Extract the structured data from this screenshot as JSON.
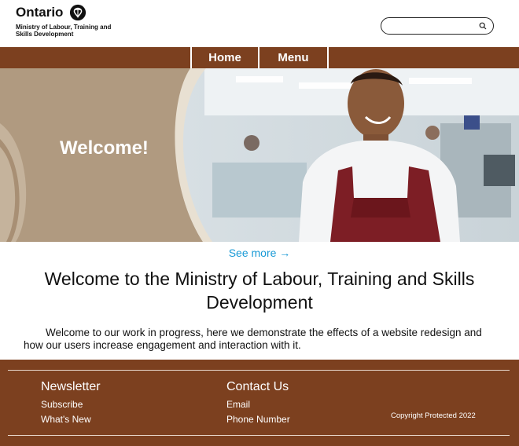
{
  "header": {
    "logo_word": "Ontario",
    "ministry_name": "Ministry of Labour, Training and Skills Development",
    "search": {
      "placeholder": "",
      "value": ""
    }
  },
  "nav": {
    "home_label": "Home",
    "menu_label": "Menu"
  },
  "hero": {
    "welcome_text": "Welcome!"
  },
  "main": {
    "see_more": "See more →",
    "title": "Welcome to the Ministry of Labour, Training and Skills Development",
    "intro": "Welcome to our work in progress, here we demonstrate the effects of a website redesign and how our users increase engagement and interaction with it."
  },
  "footer": {
    "newsletter": {
      "heading": "Newsletter",
      "links": [
        "Subscribe",
        "What's New"
      ]
    },
    "contact": {
      "heading": "Contact Us",
      "links": [
        "Email",
        "Phone Number"
      ]
    },
    "copyright": "Copyright Protected 2022"
  },
  "colors": {
    "brand_brown": "#7c401f",
    "link_blue": "#1a9ad6",
    "hero_tan": "#b09a80"
  },
  "icons": {
    "logo": "trillium-icon",
    "search": "search-icon"
  }
}
